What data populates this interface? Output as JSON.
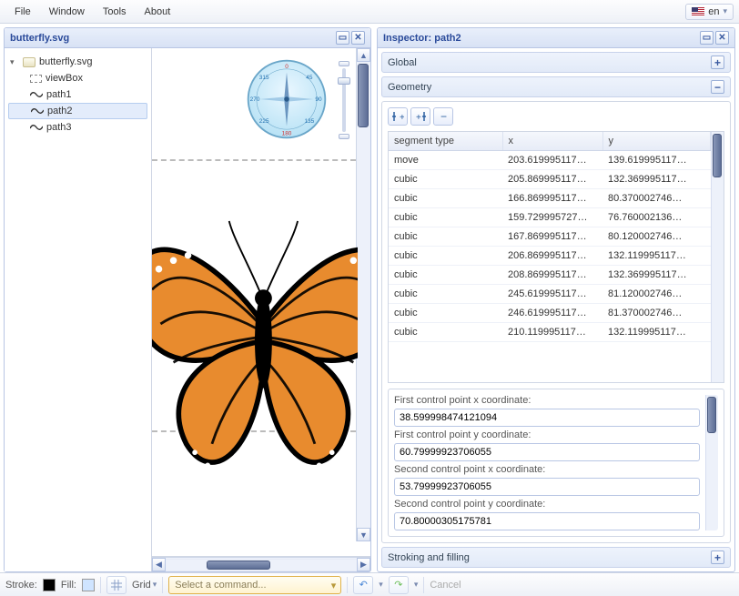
{
  "menu": {
    "file": "File",
    "window": "Window",
    "tools": "Tools",
    "about": "About",
    "lang": "en"
  },
  "leftPanel": {
    "title": "butterfly.svg",
    "tree": {
      "root": "butterfly.svg",
      "items": [
        "viewBox",
        "path1",
        "path2",
        "path3"
      ],
      "selected": "path2"
    }
  },
  "rightPanel": {
    "title": "Inspector: path2",
    "sections": {
      "global": "Global",
      "geometry": "Geometry",
      "stroking": "Stroking and filling"
    },
    "table": {
      "headers": {
        "seg": "segment type",
        "x": "x",
        "y": "y"
      },
      "rows": [
        {
          "seg": "move",
          "x": "203.619995117…",
          "y": "139.619995117…"
        },
        {
          "seg": "cubic",
          "x": "205.869995117…",
          "y": "132.369995117…"
        },
        {
          "seg": "cubic",
          "x": "166.869995117…",
          "y": "80.370002746…"
        },
        {
          "seg": "cubic",
          "x": "159.729995727…",
          "y": "76.760002136…"
        },
        {
          "seg": "cubic",
          "x": "167.869995117…",
          "y": "80.120002746…"
        },
        {
          "seg": "cubic",
          "x": "206.869995117…",
          "y": "132.119995117…"
        },
        {
          "seg": "cubic",
          "x": "208.869995117…",
          "y": "132.369995117…"
        },
        {
          "seg": "cubic",
          "x": "245.619995117…",
          "y": "81.120002746…"
        },
        {
          "seg": "cubic",
          "x": "246.619995117…",
          "y": "81.370002746…"
        },
        {
          "seg": "cubic",
          "x": "210.119995117…",
          "y": "132.119995117…"
        }
      ]
    },
    "controlPoints": {
      "cp1xLabel": "First control point x coordinate:",
      "cp1x": "38.599998474121094",
      "cp1yLabel": "First control point y coordinate:",
      "cp1y": "60.79999923706055",
      "cp2xLabel": "Second control point x coordinate:",
      "cp2x": "53.79999923706055",
      "cp2yLabel": "Second control point y coordinate:",
      "cp2y": "70.80000305175781"
    }
  },
  "bottom": {
    "strokeLabel": "Stroke:",
    "fillLabel": "Fill:",
    "gridLabel": "Grid",
    "commandPlaceholder": "Select a command...",
    "cancel": "Cancel"
  },
  "colors": {
    "accent": "#3a5aa0"
  }
}
